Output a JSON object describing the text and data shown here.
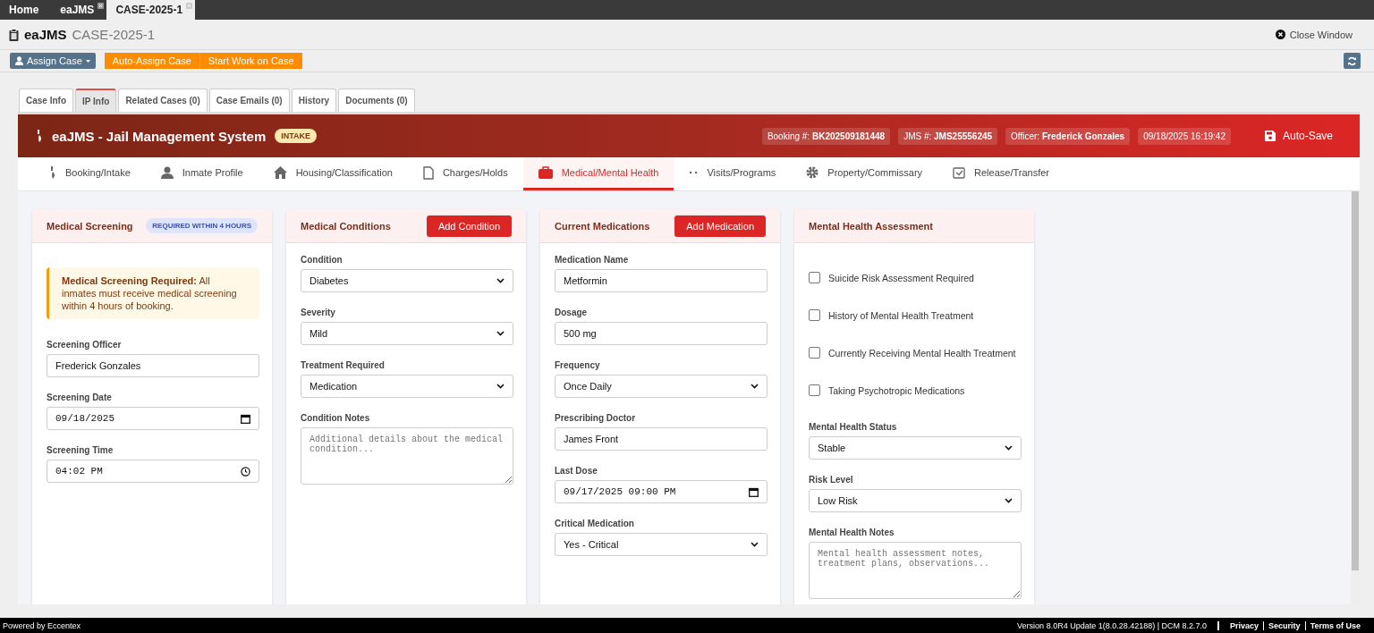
{
  "app_tabs": [
    {
      "label": "Home",
      "closable": false,
      "selected": false
    },
    {
      "label": "eaJMS",
      "closable": true,
      "selected": false
    },
    {
      "label": "CASE-2025-1",
      "closable": true,
      "selected": true
    }
  ],
  "title": {
    "app": "eaJMS",
    "case": "CASE-2025-1"
  },
  "close_window": "Close Window",
  "toolbar": {
    "assign": "Assign Case",
    "buttons": [
      "Auto-Assign Case",
      "Start Work on Case"
    ]
  },
  "case_tabs": [
    {
      "label": "Case Info",
      "selected": false
    },
    {
      "label": "IP Info",
      "selected": true
    },
    {
      "label": "Related Cases (0)",
      "selected": false
    },
    {
      "label": "Case Emails (0)",
      "selected": false
    },
    {
      "label": "History",
      "selected": false
    },
    {
      "label": "Documents (0)",
      "selected": false
    }
  ],
  "header": {
    "title": "eaJMS - Jail Management System",
    "badge": "INTAKE",
    "chips": [
      {
        "label": "Booking #:",
        "value": "BK202509181448"
      },
      {
        "label": "JMS #:",
        "value": "JMS25556245"
      },
      {
        "label": "Officer:",
        "value": "Frederick Gonzales"
      },
      {
        "value": "09/18/2025 16:19:42"
      }
    ],
    "save": "Auto-Save"
  },
  "nav": [
    {
      "label": "Booking/Intake",
      "selected": false
    },
    {
      "label": "Inmate Profile",
      "selected": false
    },
    {
      "label": "Housing/Classification",
      "selected": false
    },
    {
      "label": "Charges/Holds",
      "selected": false
    },
    {
      "label": "Medical/Mental Health",
      "selected": true
    },
    {
      "label": "Visits/Programs",
      "selected": false
    },
    {
      "label": "Property/Commissary",
      "selected": false
    },
    {
      "label": "Release/Transfer",
      "selected": false
    }
  ],
  "cards": [
    {
      "title": "Medical Screening",
      "badge": "REQUIRED WITHIN 4 HOURS",
      "alert": "**Medical Screening Required:** All inmates must receive medical screening within 4 hours of booking.",
      "fields": [
        {
          "kind": "text",
          "label": "Screening Officer",
          "value": "Frederick Gonzales"
        },
        {
          "kind": "date",
          "label": "Screening Date",
          "value": "09/18/2025"
        },
        {
          "kind": "time",
          "label": "Screening Time",
          "value": "04:02 PM"
        }
      ]
    },
    {
      "title": "Medical Conditions",
      "button": "Add Condition",
      "fields": [
        {
          "kind": "select",
          "label": "Condition",
          "value": "Diabetes"
        },
        {
          "kind": "select",
          "label": "Severity",
          "value": "Mild"
        },
        {
          "kind": "select",
          "label": "Treatment Required",
          "value": "Medication"
        },
        {
          "kind": "textarea",
          "label": "Condition Notes",
          "placeholder": "Additional details about the medical condition..."
        }
      ]
    },
    {
      "title": "Current Medications",
      "button": "Add Medication",
      "fields": [
        {
          "kind": "text",
          "label": "Medication Name",
          "value": "Metformin"
        },
        {
          "kind": "text",
          "label": "Dosage",
          "value": "500 mg"
        },
        {
          "kind": "select",
          "label": "Frequency",
          "value": "Once Daily"
        },
        {
          "kind": "text",
          "label": "Prescribing Doctor",
          "value": "James Front"
        },
        {
          "kind": "date",
          "label": "Last Dose",
          "value": "09/17/2025 09:00 PM"
        },
        {
          "kind": "select",
          "label": "Critical Medication",
          "value": "Yes - Critical"
        }
      ]
    },
    {
      "title": "Mental Health Assessment",
      "fields": [
        {
          "kind": "checkbox",
          "label": "Suicide Risk Assessment Required",
          "checked": false
        },
        {
          "kind": "checkbox",
          "label": "History of Mental Health Treatment",
          "checked": false
        },
        {
          "kind": "checkbox",
          "label": "Currently Receiving Mental Health Treatment",
          "checked": false
        },
        {
          "kind": "checkbox",
          "label": "Taking Psychotropic Medications",
          "checked": false
        },
        {
          "kind": "select",
          "label": "Mental Health Status",
          "value": "Stable"
        },
        {
          "kind": "select",
          "label": "Risk Level",
          "value": "Low Risk"
        },
        {
          "kind": "textarea",
          "label": "Mental Health Notes",
          "placeholder": "Mental health assessment notes, treatment plans, observations..."
        }
      ]
    }
  ],
  "footer": {
    "left": "Powered by Eccentex",
    "version": "Version  8.0R4 Update 1(8.0.28.42188) | DCM 8.2.7.0",
    "links": [
      "Privacy",
      "Security",
      "Terms of Use"
    ]
  }
}
